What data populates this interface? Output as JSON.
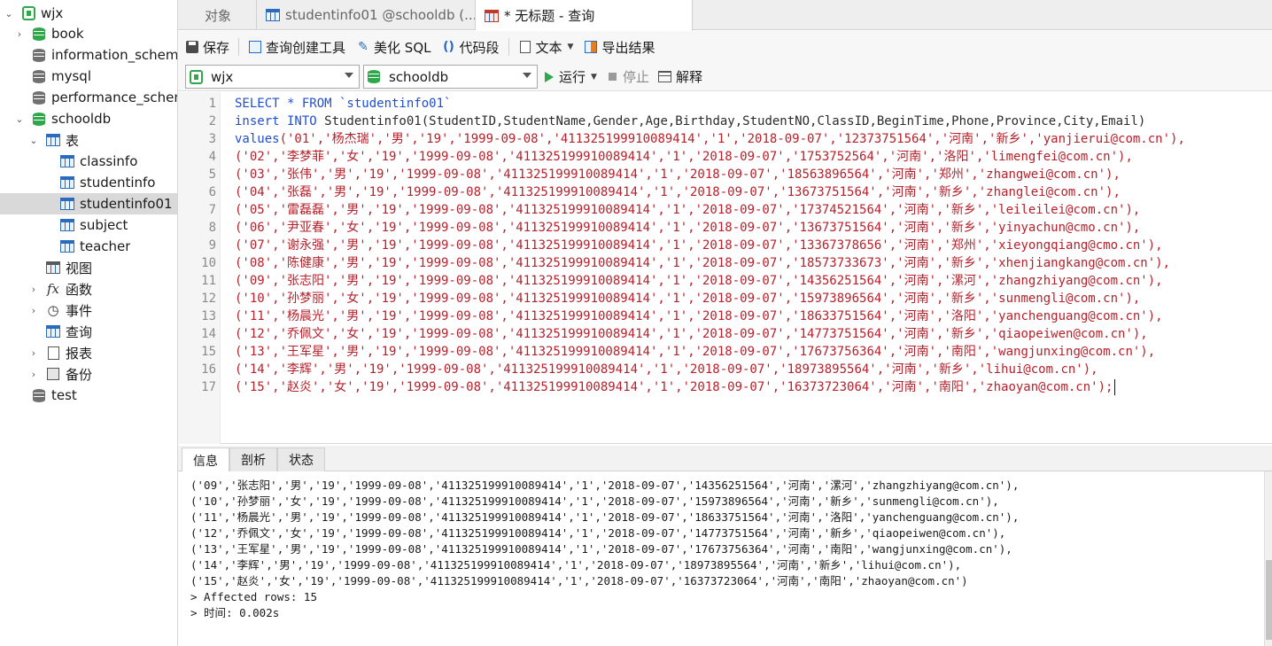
{
  "sidebar": {
    "items": [
      {
        "label": "wjx",
        "icon": "connection-icon"
      },
      {
        "label": "book",
        "icon": "database-icon"
      },
      {
        "label": "information_schema",
        "icon": "database-icon"
      },
      {
        "label": "mysql",
        "icon": "database-icon"
      },
      {
        "label": "performance_schema",
        "icon": "database-icon"
      },
      {
        "label": "schooldb",
        "icon": "database-icon"
      },
      {
        "label": "表",
        "icon": "tables-icon"
      },
      {
        "label": "classinfo",
        "icon": "table-icon"
      },
      {
        "label": "studentinfo",
        "icon": "table-icon"
      },
      {
        "label": "studentinfo01",
        "icon": "table-icon"
      },
      {
        "label": "subject",
        "icon": "table-icon"
      },
      {
        "label": "teacher",
        "icon": "table-icon"
      },
      {
        "label": "视图",
        "icon": "view-icon"
      },
      {
        "label": "函数",
        "icon": "function-icon"
      },
      {
        "label": "事件",
        "icon": "event-icon"
      },
      {
        "label": "查询",
        "icon": "query-icon"
      },
      {
        "label": "报表",
        "icon": "report-icon"
      },
      {
        "label": "备份",
        "icon": "backup-icon"
      },
      {
        "label": "test",
        "icon": "database-icon"
      }
    ],
    "selected": "studentinfo01"
  },
  "tabs": [
    {
      "label": "对象"
    },
    {
      "label": "studentinfo01 @schooldb (..."
    },
    {
      "label": "* 无标题 - 查询"
    }
  ],
  "toolbar": {
    "save": "保存",
    "query_builder": "查询创建工具",
    "beautify": "美化 SQL",
    "snippet": "代码段",
    "text": "文本",
    "export": "导出结果"
  },
  "selectors": {
    "connection": "wjx",
    "database": "schooldb",
    "run": "运行",
    "stop": "停止",
    "explain": "解释"
  },
  "editor": {
    "line_numbers": [
      "1",
      "2",
      "3",
      "4",
      "5",
      "6",
      "7",
      "8",
      "9",
      "10",
      "11",
      "12",
      "13",
      "14",
      "15",
      "16",
      "17"
    ],
    "line1": "SELECT * FROM `studentinfo01`",
    "line2_kw": "insert INTO",
    "line2_rest": " Studentinfo01(StudentID,StudentName,Gender,Age,Birthday,StudentNO,ClassID,BeginTime,Phone,Province,City,Email)",
    "values_kw": "values",
    "rows": [
      "('01','杨杰瑞','男','19','1999-09-08','411325199910089414','1','2018-09-07','12373751564','河南','新乡','yanjierui@com.cn'),",
      "('02','李梦菲','女','19','1999-09-08','411325199910089414','1','2018-09-07','1753752564','河南','洛阳','limengfei@com.cn'),",
      "('03','张伟','男','19','1999-09-08','411325199910089414','1','2018-09-07','18563896564','河南','郑州','zhangwei@com.cn'),",
      "('04','张磊','男','19','1999-09-08','411325199910089414','1','2018-09-07','13673751564','河南','新乡','zhanglei@com.cn'),",
      "('05','雷磊磊','男','19','1999-09-08','411325199910089414','1','2018-09-07','17374521564','河南','新乡','leileilei@com.cn'),",
      "('06','尹亚春','女','19','1999-09-08','411325199910089414','1','2018-09-07','13673751564','河南','新乡','yinyachun@cmo.cn'),",
      "('07','谢永强','男','19','1999-09-08','411325199910089414','1','2018-09-07','13367378656','河南','郑州','xieyongqiang@cmo.cn'),",
      "('08','陈健康','男','19','1999-09-08','411325199910089414','1','2018-09-07','18573733673','河南','新乡','xhenjiangkang@com.cn'),",
      "('09','张志阳','男','19','1999-09-08','411325199910089414','1','2018-09-07','14356251564','河南','漯河','zhangzhiyang@com.cn'),",
      "('10','孙梦丽','女','19','1999-09-08','411325199910089414','1','2018-09-07','15973896564','河南','新乡','sunmengli@com.cn'),",
      "('11','杨晨光','男','19','1999-09-08','411325199910089414','1','2018-09-07','18633751564','河南','洛阳','yanchenguang@com.cn'),",
      "('12','乔佩文','女','19','1999-09-08','411325199910089414','1','2018-09-07','14773751564','河南','新乡','qiaopeiwen@com.cn'),",
      "('13','王军星','男','19','1999-09-08','411325199910089414','1','2018-09-07','17673756364','河南','南阳','wangjunxing@com.cn'),",
      "('14','李辉','男','19','1999-09-08','411325199910089414','1','2018-09-07','18973895564','河南','新乡','lihui@com.cn'),",
      "('15','赵炎','女','19','1999-09-08','411325199910089414','1','2018-09-07','16373723064','河南','南阳','zhaoyan@com.cn');"
    ]
  },
  "panel_tabs": [
    {
      "label": "信息"
    },
    {
      "label": "剖析"
    },
    {
      "label": "状态"
    }
  ],
  "output": {
    "lines": [
      "('09','张志阳','男','19','1999-09-08','411325199910089414','1','2018-09-07','14356251564','河南','漯河','zhangzhiyang@com.cn'),",
      "('10','孙梦丽','女','19','1999-09-08','411325199910089414','1','2018-09-07','15973896564','河南','新乡','sunmengli@com.cn'),",
      "('11','杨晨光','男','19','1999-09-08','411325199910089414','1','2018-09-07','18633751564','河南','洛阳','yanchenguang@com.cn'),",
      "('12','乔佩文','女','19','1999-09-08','411325199910089414','1','2018-09-07','14773751564','河南','新乡','qiaopeiwen@com.cn'),",
      "('13','王军星','男','19','1999-09-08','411325199910089414','1','2018-09-07','17673756364','河南','南阳','wangjunxing@com.cn'),",
      "('14','李辉','男','19','1999-09-08','411325199910089414','1','2018-09-07','18973895564','河南','新乡','lihui@com.cn'),",
      "('15','赵炎','女','19','1999-09-08','411325199910089414','1','2018-09-07','16373723064','河南','南阳','zhaoyan@com.cn')",
      "> Affected rows: 15",
      "> 时间: 0.002s"
    ]
  },
  "colors": {
    "keyword": "#1f4fd1",
    "string": "#b6212b",
    "selected_row": "#d9d9d9",
    "db_icon": "#2ea84a"
  }
}
